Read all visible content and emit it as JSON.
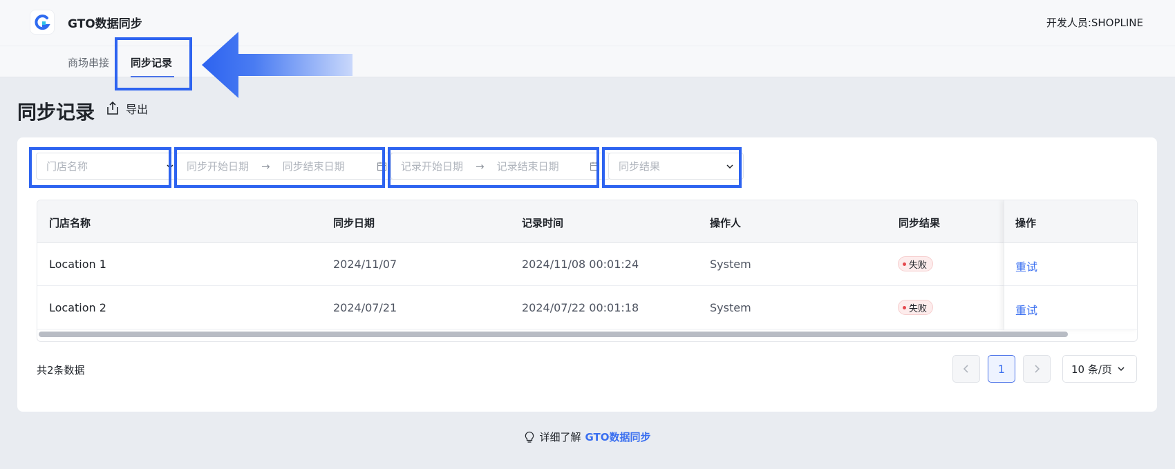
{
  "header": {
    "app_title": "GTO数据同步",
    "developer": "开发人员:SHOPLINE"
  },
  "tabs": [
    {
      "label": "商场串接",
      "active": false
    },
    {
      "label": "同步记录",
      "active": true
    }
  ],
  "page": {
    "title": "同步记录",
    "export_label": "导出"
  },
  "filters": {
    "store_placeholder": "门店名称",
    "sync_start_placeholder": "同步开始日期",
    "sync_end_placeholder": "同步结束日期",
    "record_start_placeholder": "记录开始日期",
    "record_end_placeholder": "记录结束日期",
    "result_placeholder": "同步结果",
    "separator": "→"
  },
  "table": {
    "columns": [
      "门店名称",
      "同步日期",
      "记录时间",
      "操作人",
      "同步结果",
      "操作"
    ],
    "rows": [
      {
        "store": "Location 1",
        "sync_date": "2024/11/07",
        "record_time": "2024/11/08 00:01:24",
        "operator": "System",
        "result": "失败",
        "action": "重试"
      },
      {
        "store": "Location 2",
        "sync_date": "2024/07/21",
        "record_time": "2024/07/22 00:01:18",
        "operator": "System",
        "result": "失败",
        "action": "重试"
      }
    ]
  },
  "pagination": {
    "total": "共2条数据",
    "current_page": "1",
    "page_size": "10 条/页"
  },
  "footer": {
    "prefix": "详细了解",
    "link": "GTO数据同步"
  },
  "colors": {
    "accent": "#3a6ff0",
    "highlight": "#2d63f0",
    "fail": "#e5484d"
  }
}
